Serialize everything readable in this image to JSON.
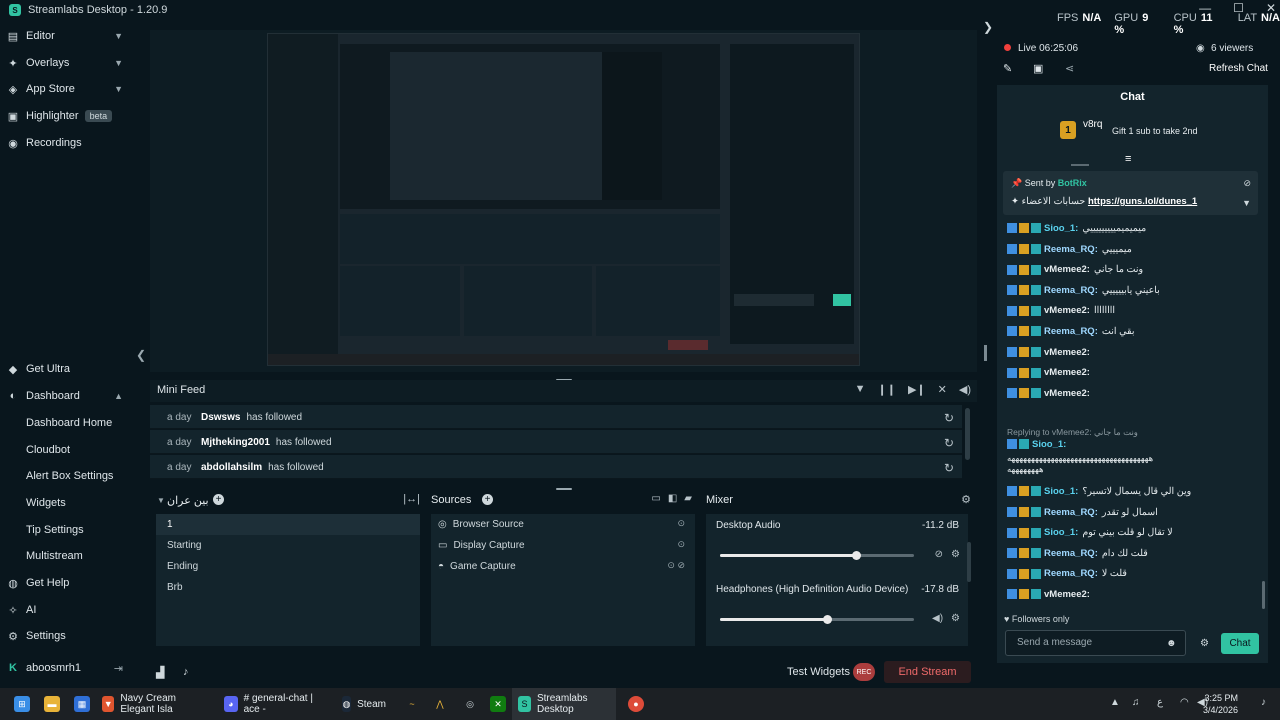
{
  "app": {
    "title": "Streamlabs Desktop - 1.20.9",
    "window_controls": [
      "—",
      "☐",
      "✕"
    ]
  },
  "stats": [
    {
      "label": "FPS",
      "value": "N/A"
    },
    {
      "label": "GPU",
      "value": "9 %"
    },
    {
      "label": "CPU",
      "value": "11 %"
    },
    {
      "label": "LAT",
      "value": "N/A"
    }
  ],
  "sidebar": {
    "top": [
      {
        "label": "Editor",
        "icon": "editor-icon"
      },
      {
        "label": "Overlays",
        "icon": "overlays-icon"
      },
      {
        "label": "App Store",
        "icon": "app-store-icon"
      },
      {
        "label": "Highlighter",
        "icon": "highlighter-icon",
        "badge": "beta"
      },
      {
        "label": "Recordings",
        "icon": "recordings-icon"
      }
    ],
    "get_ultra": "Get Ultra",
    "dashboard": "Dashboard",
    "dashboard_items": [
      "Dashboard Home",
      "Cloudbot",
      "Alert Box Settings",
      "Widgets",
      "Tip Settings",
      "Multistream"
    ],
    "get_help": "Get Help",
    "ai": "AI",
    "settings": "Settings",
    "user": "aboosmrh1"
  },
  "mini_feed": {
    "title": "Mini Feed",
    "rows": [
      {
        "ago": "a day",
        "name": "Dswsws",
        "action": "has followed"
      },
      {
        "ago": "a day",
        "name": "Mjtheking2001",
        "action": "has followed"
      },
      {
        "ago": "a day",
        "name": "abdollahsilm",
        "action": "has followed"
      }
    ]
  },
  "scenes": {
    "title": "بين عران",
    "items": [
      "1",
      "Starting",
      "Ending",
      "Brb"
    ],
    "selected": 0
  },
  "sources": {
    "title": "Sources",
    "items": [
      "Browser Source",
      "Display Capture",
      "Game Capture"
    ]
  },
  "mixer": {
    "title": "Mixer",
    "channels": [
      {
        "name": "Desktop Audio",
        "db": "-11.2 dB",
        "level": 0.7
      },
      {
        "name": "Headphones (High Definition Audio Device)",
        "db": "-17.8 dB",
        "level": 0.55
      }
    ]
  },
  "footer": {
    "test_widgets": "Test Widgets",
    "rec": "REC",
    "end_stream": "End Stream"
  },
  "live": {
    "status": "Live 06:25:06",
    "viewers": "6 viewers",
    "refresh": "Refresh Chat"
  },
  "chat": {
    "title": "Chat",
    "gift_user": "v8rq",
    "gift_rank": "1",
    "gift_text": "Gift 1 sub to take 2nd",
    "pinned_by": "Sent by",
    "pinned_user": "BotRix",
    "pinned_text": "حسابات الاعضاء",
    "pinned_link": "https://guns.lol/dunes_1",
    "messages": [
      {
        "user": "Sioo_1:",
        "text": "ميميميميييييييييي",
        "color": "#5ad2ee"
      },
      {
        "user": "Reema_RQ:",
        "text": "ميميييي",
        "color": "#9fd8ff"
      },
      {
        "user": "vMemee2:",
        "text": "ونت ما جاني",
        "color": "#e6ecef"
      },
      {
        "user": "Reema_RQ:",
        "text": "باعيني يابيييييي",
        "color": "#9fd8ff"
      },
      {
        "user": "vMemee2:",
        "text": "اااااااا",
        "color": "#e6ecef"
      },
      {
        "user": "Reema_RQ:",
        "text": "بقي انت",
        "color": "#9fd8ff"
      },
      {
        "user": "vMemee2:",
        "text": "",
        "color": "#e6ecef"
      },
      {
        "user": "vMemee2:",
        "text": "",
        "color": "#e6ecef"
      },
      {
        "user": "vMemee2:",
        "text": "",
        "color": "#e6ecef"
      }
    ],
    "reply_note": "Replying to vMemee2: ونت ما جاني",
    "reply_user": "Sioo_1:",
    "reply_text": "ههههههههههههههههههههههههههههههههههههه",
    "reply_text2": "ههههههههه",
    "messages2": [
      {
        "user": "Sioo_1:",
        "text": "وين الي قال يسمال لاتسير؟",
        "color": "#5ad2ee"
      },
      {
        "user": "Reema_RQ:",
        "text": "اسمال لو تقدر",
        "color": "#9fd8ff"
      },
      {
        "user": "Sioo_1:",
        "text": "لا تقال لو قلت بيني توم",
        "color": "#5ad2ee"
      },
      {
        "user": "Reema_RQ:",
        "text": "قلت لك دام",
        "color": "#9fd8ff"
      },
      {
        "user": "Reema_RQ:",
        "text": "قلت لا",
        "color": "#9fd8ff"
      },
      {
        "user": "vMemee2:",
        "text": "",
        "color": "#e6ecef"
      }
    ],
    "followers_only": "Followers only",
    "input_placeholder": "Send a message",
    "send": "Chat"
  },
  "taskbar": {
    "items": [
      {
        "label": "Navy Cream Elegant Isla"
      },
      {
        "label": "# general-chat | ace -"
      },
      {
        "label": "Steam"
      },
      {
        "label": "Streamlabs Desktop"
      }
    ],
    "time": "3:25 PM",
    "date": "3/4/2026",
    "lang": "ع"
  },
  "colors": {
    "accent": "#31c3a2",
    "live": "#f1403c",
    "end_stream": "#ef6a6a",
    "bg": "#09161d"
  }
}
